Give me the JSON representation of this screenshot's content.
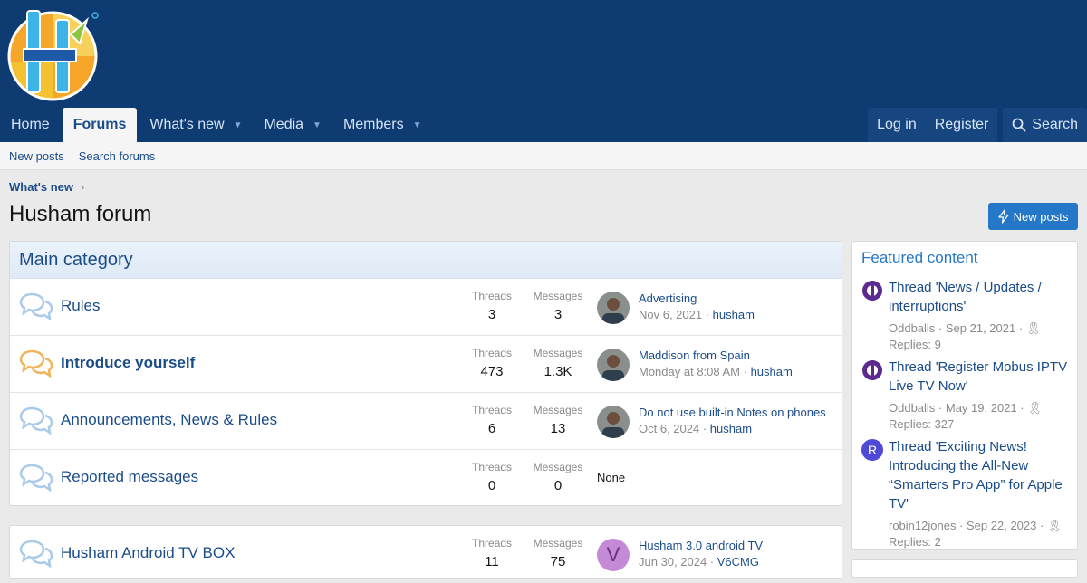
{
  "colors": {
    "header_bg": "#0f3b73",
    "accent": "#2577c8",
    "link": "#1a4c8a"
  },
  "nav": {
    "items": [
      {
        "label": "Home",
        "active": false
      },
      {
        "label": "Forums",
        "active": true
      },
      {
        "label": "What's new",
        "active": false,
        "has_dropdown": true
      },
      {
        "label": "Media",
        "active": false,
        "has_dropdown": true
      },
      {
        "label": "Members",
        "active": false,
        "has_dropdown": true
      }
    ],
    "login": "Log in",
    "register": "Register",
    "search": "Search"
  },
  "subnav": {
    "new_posts": "New posts",
    "search_forums": "Search forums"
  },
  "breadcrumb": "What's new",
  "page_title": "Husham forum",
  "new_posts_button": "New posts",
  "main_category": {
    "title": "Main category",
    "stat_labels": {
      "threads": "Threads",
      "messages": "Messages"
    },
    "nodes": [
      {
        "title": "Rules",
        "threads": "3",
        "messages": "3",
        "last_title": "Advertising",
        "last_date": "Nov 6, 2021",
        "last_user": "husham",
        "unread": false
      },
      {
        "title": "Introduce yourself",
        "threads": "473",
        "messages": "1.3K",
        "last_title": "Maddison from Spain",
        "last_date": "Monday at 8:08 AM",
        "last_user": "husham",
        "unread": true
      },
      {
        "title": "Announcements, News & Rules",
        "threads": "6",
        "messages": "13",
        "last_title": "Do not use built-in Notes on phones",
        "last_date": "Oct 6, 2024",
        "last_user": "husham",
        "unread": false
      },
      {
        "title": "Reported messages",
        "threads": "0",
        "messages": "0",
        "none": "None",
        "unread": false
      }
    ]
  },
  "second_category": {
    "nodes": [
      {
        "title": "Husham Android TV BOX",
        "threads": "11",
        "messages": "75",
        "last_title": "Husham 3.0 android TV",
        "last_date": "Jun 30, 2024",
        "last_user": "V6CMG",
        "avatar_letter": "V"
      }
    ]
  },
  "featured": {
    "title": "Featured content",
    "items": [
      {
        "title": "Thread 'News / Updates / interruptions'",
        "user": "Oddballs",
        "date": "Sep 21, 2021",
        "replies": "Replies: 9"
      },
      {
        "title": "Thread 'Register Mobus IPTV Live TV Now'",
        "user": "Oddballs",
        "date": "May 19, 2021",
        "replies": "Replies: 327"
      },
      {
        "title": "Thread 'Exciting News! Introducing the All-New “Smarters Pro App” for Apple TV'",
        "user": "robin12jones",
        "date": "Sep 22, 2023",
        "replies": "Replies: 2",
        "avatar_letter": "R"
      }
    ]
  }
}
